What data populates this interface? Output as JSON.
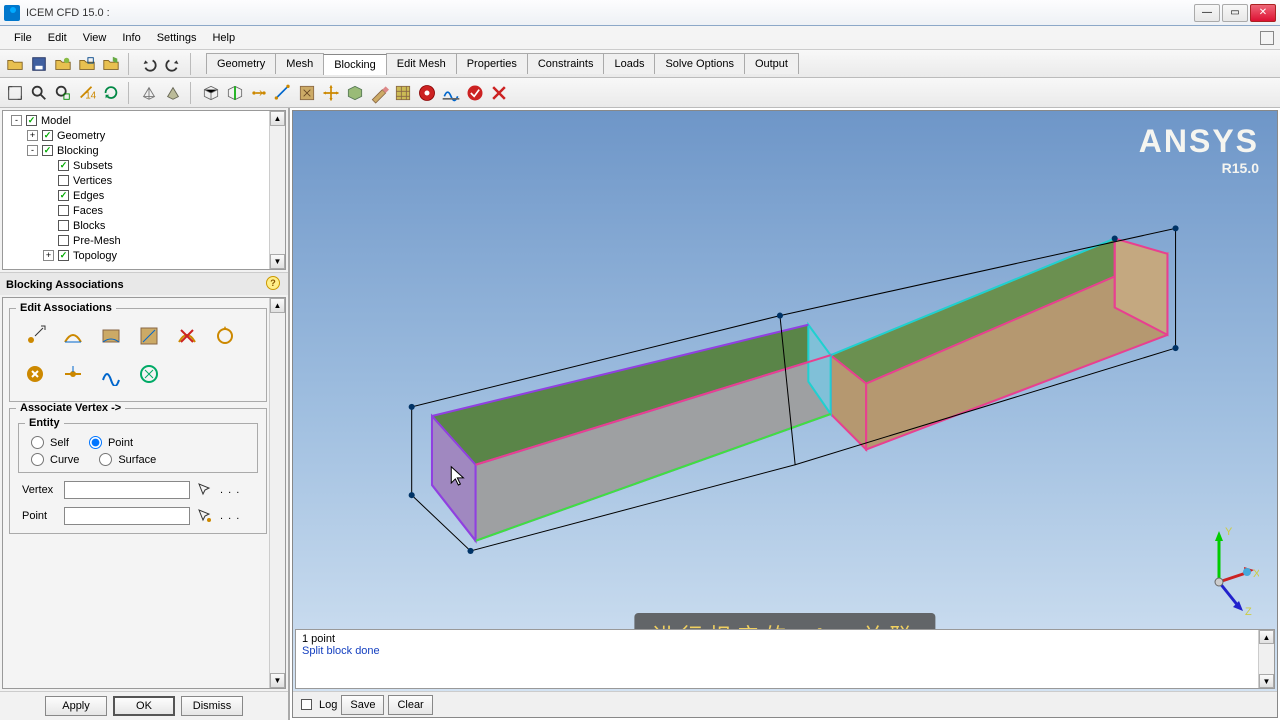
{
  "title": "ICEM CFD 15.0 :",
  "menus": [
    "File",
    "Edit",
    "View",
    "Info",
    "Settings",
    "Help"
  ],
  "mainTabs": [
    "Geometry",
    "Mesh",
    "Blocking",
    "Edit Mesh",
    "Properties",
    "Constraints",
    "Loads",
    "Solve Options",
    "Output"
  ],
  "activeTab": "Blocking",
  "tree": [
    {
      "indent": 0,
      "exp": "-",
      "chk": true,
      "label": "Model"
    },
    {
      "indent": 1,
      "exp": "+",
      "chk": true,
      "label": "Geometry"
    },
    {
      "indent": 1,
      "exp": "-",
      "chk": true,
      "label": "Blocking"
    },
    {
      "indent": 2,
      "exp": "",
      "chk": true,
      "label": "Subsets"
    },
    {
      "indent": 2,
      "exp": "",
      "chk": false,
      "label": "Vertices"
    },
    {
      "indent": 2,
      "exp": "",
      "chk": true,
      "label": "Edges"
    },
    {
      "indent": 2,
      "exp": "",
      "chk": false,
      "label": "Faces"
    },
    {
      "indent": 2,
      "exp": "",
      "chk": false,
      "label": "Blocks"
    },
    {
      "indent": 2,
      "exp": "",
      "chk": false,
      "label": "Pre-Mesh"
    },
    {
      "indent": 2,
      "exp": "+",
      "chk": true,
      "label": "Topology"
    }
  ],
  "panelTitle": "Blocking Associations",
  "editGroup": "Edit Associations",
  "assocGroup": "Associate Vertex ->",
  "entityGroup": "Entity",
  "entityRadios": {
    "self": "Self",
    "point": "Point",
    "curve": "Curve",
    "surface": "Surface",
    "selected": "point"
  },
  "fields": {
    "vertex": {
      "label": "Vertex",
      "value": ""
    },
    "point": {
      "label": "Point",
      "value": ""
    }
  },
  "bottomButtons": {
    "apply": "Apply",
    "ok": "OK",
    "dismiss": "Dismiss"
  },
  "brand": {
    "name": "ANSYS",
    "version": "R15.0"
  },
  "triad": {
    "x": "X",
    "y": "Y",
    "z": "Z"
  },
  "console": {
    "line1": "1 point",
    "line2": "Split block done",
    "logLabel": "Log",
    "save": "Save",
    "clear": "Clear"
  },
  "subtitle": "进行相应的Edge关联"
}
